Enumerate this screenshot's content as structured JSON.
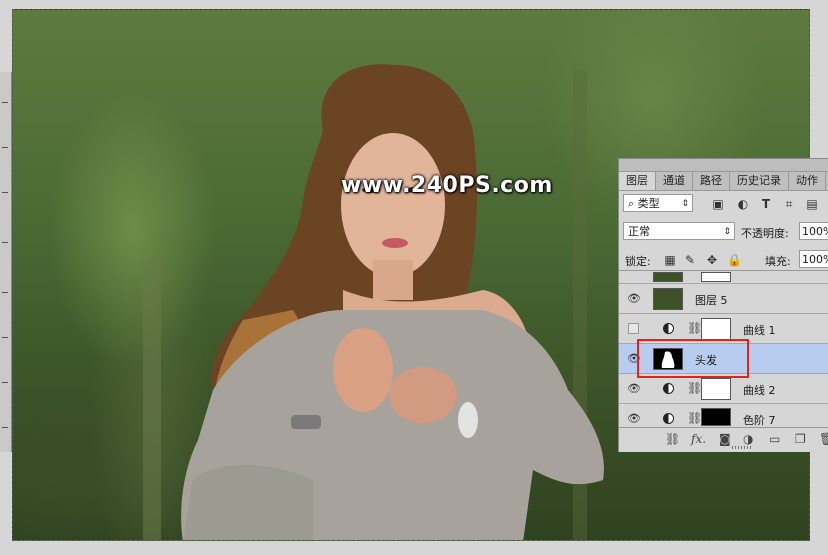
{
  "watermark": "www.240PS.com",
  "tabs": [
    {
      "label": "图层",
      "active": true
    },
    {
      "label": "通道",
      "active": false
    },
    {
      "label": "路径",
      "active": false
    },
    {
      "label": "历史记录",
      "active": false
    },
    {
      "label": "动作",
      "active": false
    }
  ],
  "filter": {
    "icon": "search-icon",
    "value": "类型"
  },
  "blend_mode": "正常",
  "opacity": {
    "label": "不透明度:",
    "value": "100%"
  },
  "lock": {
    "label": "锁定:"
  },
  "fill": {
    "label": "填充:",
    "value": "100%"
  },
  "layers": [
    {
      "name": "图层 5",
      "visible": true,
      "thumb_color": "#3e5227",
      "type": "pixel"
    },
    {
      "name": "曲线 1",
      "visible": false,
      "type": "adjustment"
    },
    {
      "name": "头发",
      "visible": true,
      "type": "pixel-mask",
      "selected": true
    },
    {
      "name": "曲线 2",
      "visible": true,
      "type": "adjustment"
    },
    {
      "name": "色阶 7",
      "visible": true,
      "type": "adjustment-dark"
    }
  ],
  "footer_icons": [
    "link-icon",
    "fx-icon",
    "mask-icon",
    "adjustment-icon",
    "folder-icon",
    "new-layer-icon",
    "trash-icon"
  ],
  "footer_fx": "fx.",
  "colors": {
    "selection_highlight": "#b8ccf0",
    "annotation_red": "#e0241c"
  }
}
